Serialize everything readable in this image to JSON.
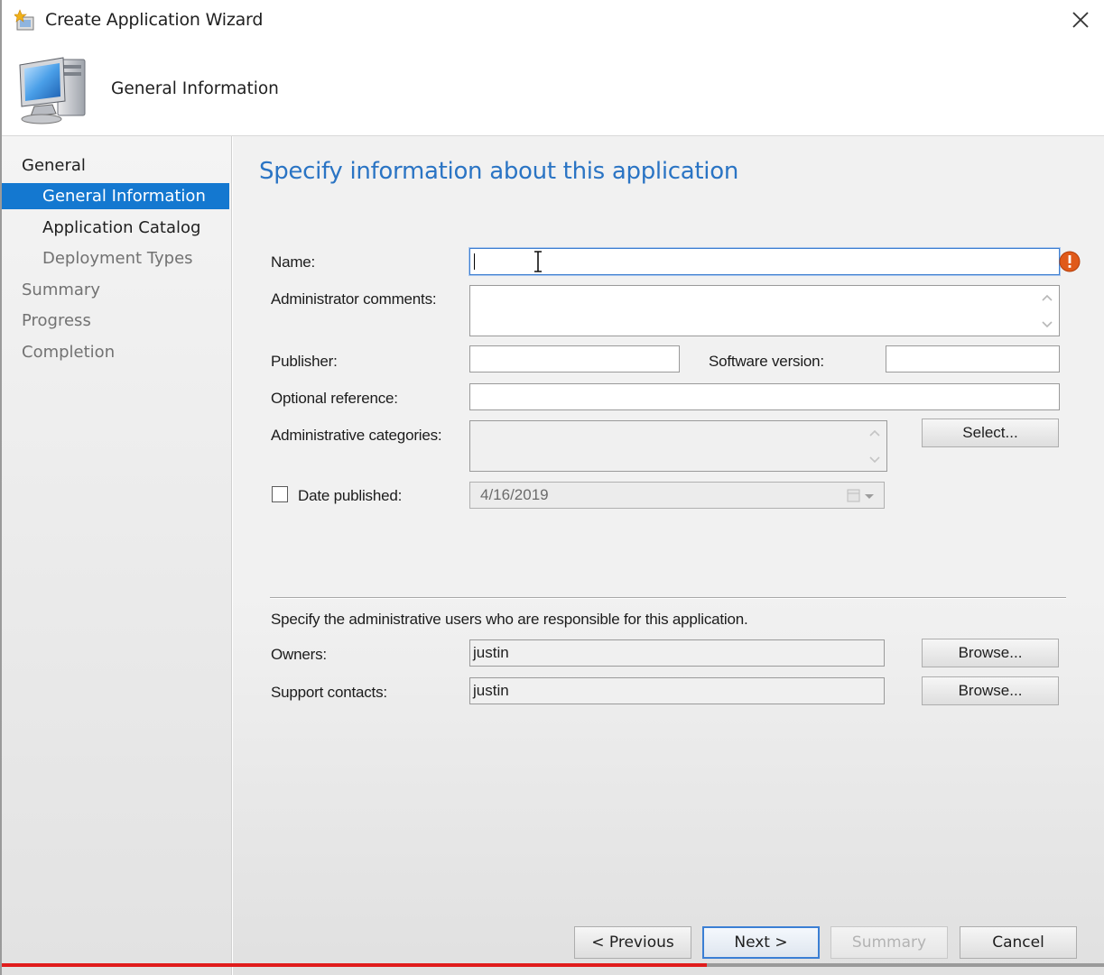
{
  "window": {
    "title": "Create Application Wizard",
    "header_title": "General Information"
  },
  "sidebar": {
    "items": [
      {
        "label": "General",
        "state": "enabled"
      },
      {
        "label": "General Information",
        "state": "active"
      },
      {
        "label": "Application Catalog",
        "state": "enabled"
      },
      {
        "label": "Deployment Types",
        "state": "disabled"
      },
      {
        "label": "Summary",
        "state": "disabled"
      },
      {
        "label": "Progress",
        "state": "disabled"
      },
      {
        "label": "Completion",
        "state": "disabled"
      }
    ]
  },
  "main": {
    "heading": "Specify information about this application",
    "fields": {
      "name": {
        "label": "Name:",
        "value": ""
      },
      "admin_comments": {
        "label": "Administrator comments:",
        "value": ""
      },
      "publisher": {
        "label": "Publisher:",
        "value": ""
      },
      "software_version": {
        "label": "Software version:",
        "value": ""
      },
      "optional_reference": {
        "label": "Optional reference:",
        "value": ""
      },
      "admin_categories": {
        "label": "Administrative categories:",
        "value": ""
      },
      "date_published": {
        "label": "Date published:",
        "value": "4/16/2019",
        "checked": false
      }
    },
    "select_button": "Select...",
    "responsible_text": "Specify the administrative users who are responsible for this application.",
    "owners": {
      "label": "Owners:",
      "value": "justin",
      "button": "Browse..."
    },
    "support_contacts": {
      "label": "Support contacts:",
      "value": "justin",
      "button": "Browse..."
    }
  },
  "footer": {
    "previous": "< Previous",
    "next": "Next >",
    "summary": "Summary",
    "cancel": "Cancel"
  },
  "video_progress": {
    "played_fraction": 0.64
  },
  "colors": {
    "accent": "#1478d0",
    "heading": "#2a74c4",
    "warning": "#e05a1a"
  }
}
